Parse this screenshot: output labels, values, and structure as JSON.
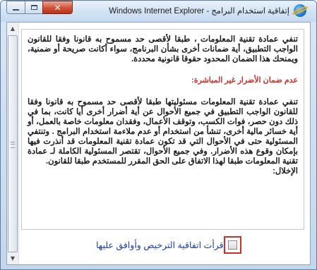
{
  "window": {
    "title": "إتفاقية استخدام البرامج - Windows Internet Explorer",
    "icon": "internet-explorer-icon",
    "controls": {
      "minimize_icon": "minimize-icon",
      "maximize_icon": "maximize-icon",
      "close_label": "✕"
    }
  },
  "license": {
    "paragraph1": "تنفي عمادة تقنية المعلومات ، طبقا لأقصى حد مسموح به قانونا وفقا للقانون الواجب التطبيق، أية ضمانات أخرى بشأن البرنامج، سواء أكانت صريحة أو ضمنية، ويمنحك هذا الضمان المحدود حقوقا قانونية محددة.",
    "heading": "عدم ضمان الأضرار غير المباشرة:",
    "paragraph2": "تنفي عمادة تقنية المعلومات مسئوليتها طبقا لأقصى حد مسموح به قانونا وفقا للقانون الواجب التطبيق في جميع الأحوال عن أية أضرار أخرى أيا كانت، بما في ذلك دون حصر، فوات الكسب، وتوقف الأعمال، وفقدان معلومات خاصة بالعمل، أو أية خسائر مالية أخرى، تنشأ من استخدام أو عدم ملاءمة استخدام البرامج . وتنتفي المسئولية حتى في الأحوال التي قد تكون عمادة تقنية المعلومات قد أنذرت فيها بإمكان وقوع هذه الأضرار. وفي جميع الأحوال، تقتصر المسئولية الكاملة لـ عمادة تقنية المعلومات طبقا لهذا الاتفاق على الحق المقرر للمستخدم طبقا للقانون.",
    "tail": "الإخلال:"
  },
  "agreement": {
    "label": "قرأت اتفاقية الترخيص وأوافق عليها",
    "checked": false
  },
  "colors": {
    "heading": "#c8302a",
    "agree_label": "#1c3ea8",
    "checkbox_frame": "#c8302a"
  }
}
